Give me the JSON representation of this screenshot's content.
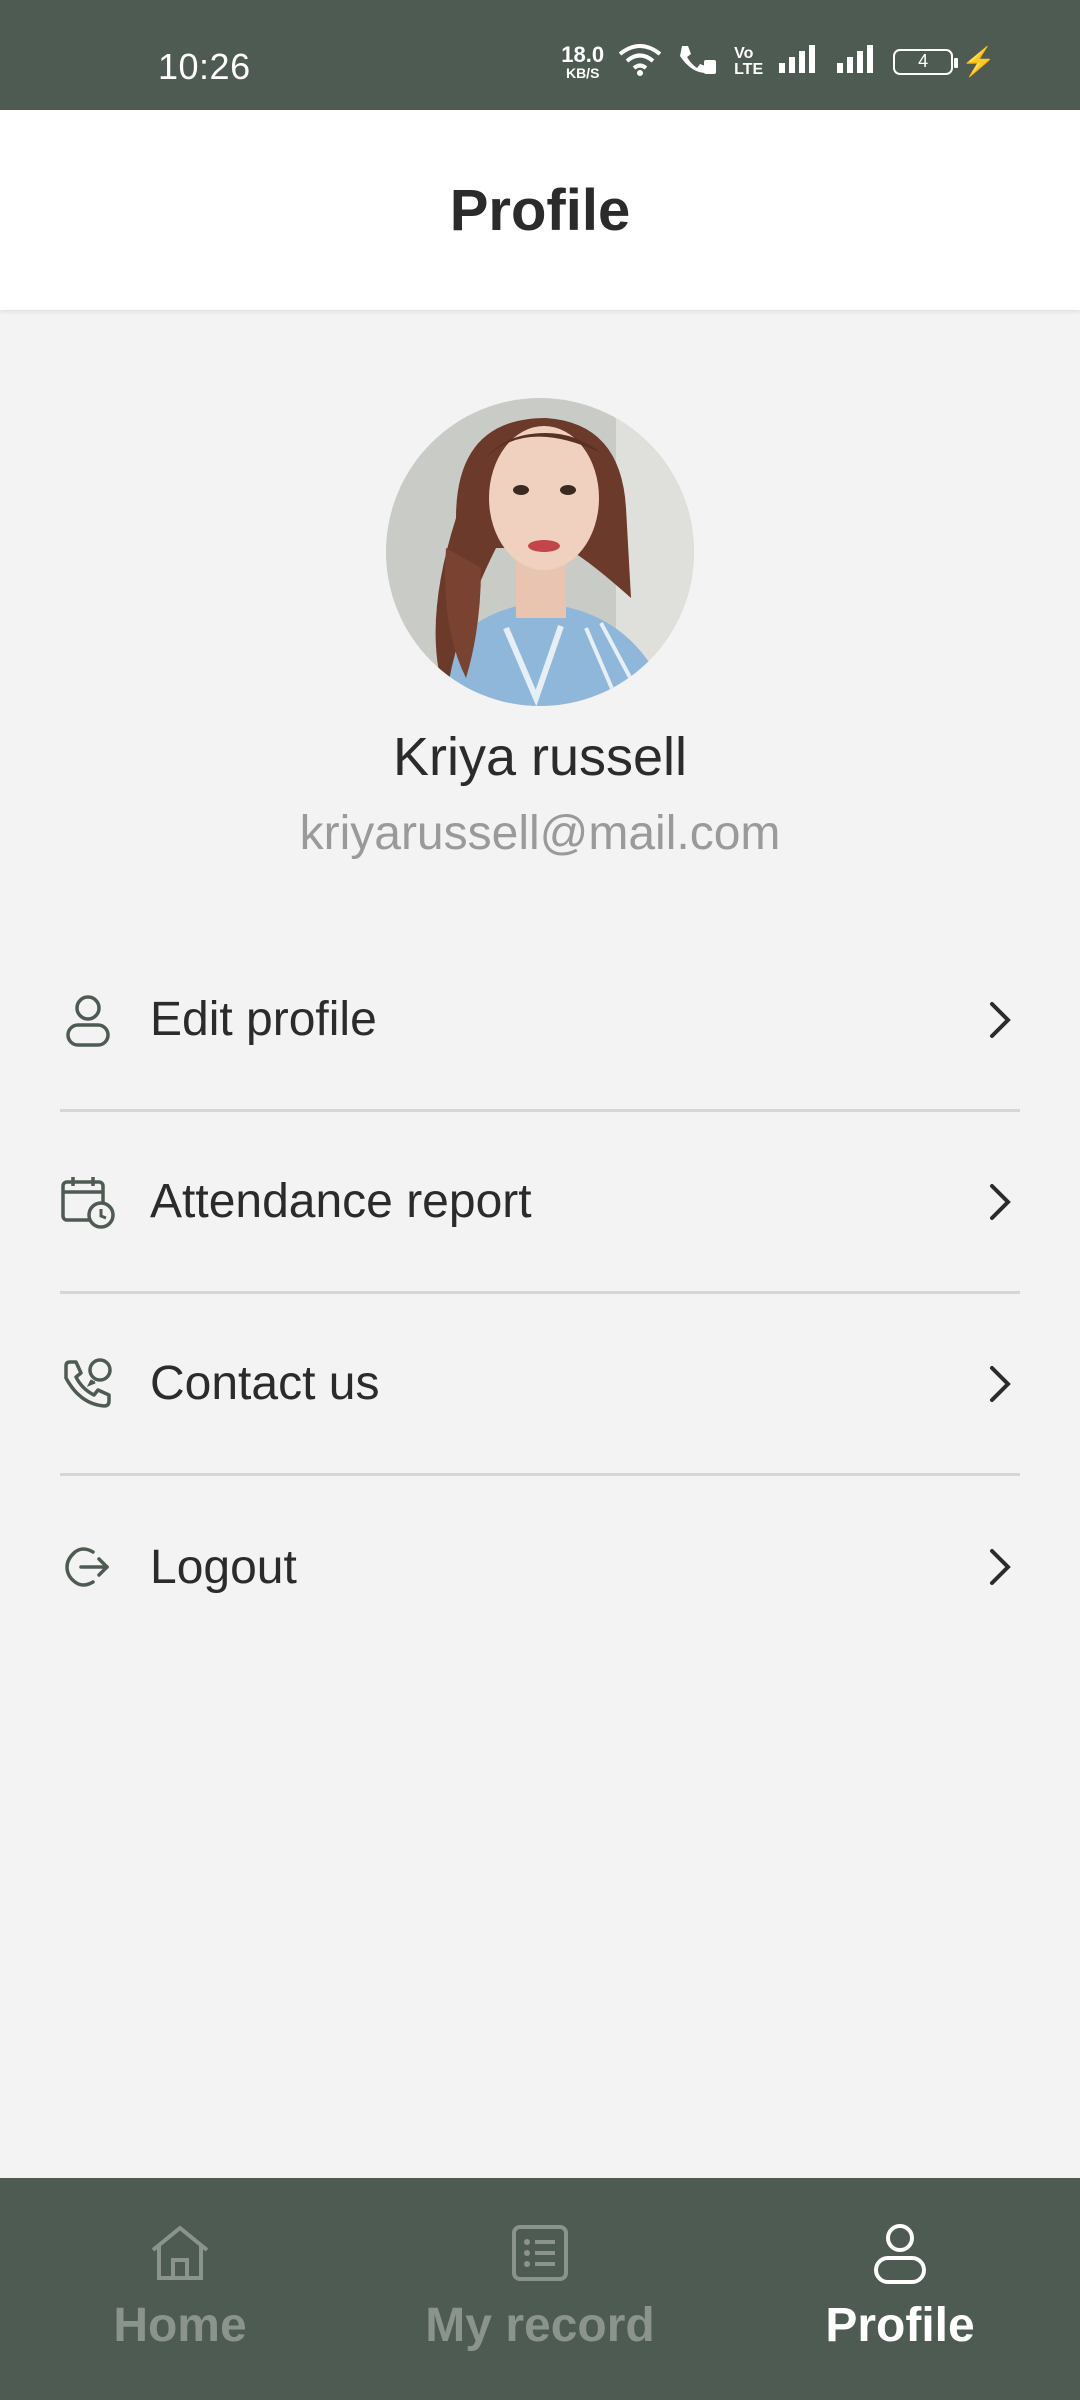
{
  "status_bar": {
    "time": "10:26",
    "speed_value": "18.0",
    "speed_unit": "KB/S",
    "volte_top": "Vo",
    "volte_bottom": "LTE",
    "battery": "4"
  },
  "header": {
    "title": "Profile"
  },
  "profile": {
    "name": "Kriya russell",
    "email": "kriyarussell@mail.com"
  },
  "menu": {
    "items": [
      {
        "label": "Edit profile",
        "icon": "user-icon"
      },
      {
        "label": "Attendance report",
        "icon": "calendar-clock-icon"
      },
      {
        "label": "Contact us",
        "icon": "phone-chat-icon"
      },
      {
        "label": "Logout",
        "icon": "logout-icon"
      }
    ]
  },
  "bottom_nav": {
    "items": [
      {
        "label": "Home",
        "icon": "home-icon",
        "active": false
      },
      {
        "label": "My record",
        "icon": "list-icon",
        "active": false
      },
      {
        "label": "Profile",
        "icon": "user-icon",
        "active": true
      }
    ]
  },
  "colors": {
    "primary": "#4e5b52",
    "background": "#f3f3f3",
    "text": "#2b2b2b",
    "muted": "#9a9a9a",
    "charging": "#3fb85a"
  }
}
